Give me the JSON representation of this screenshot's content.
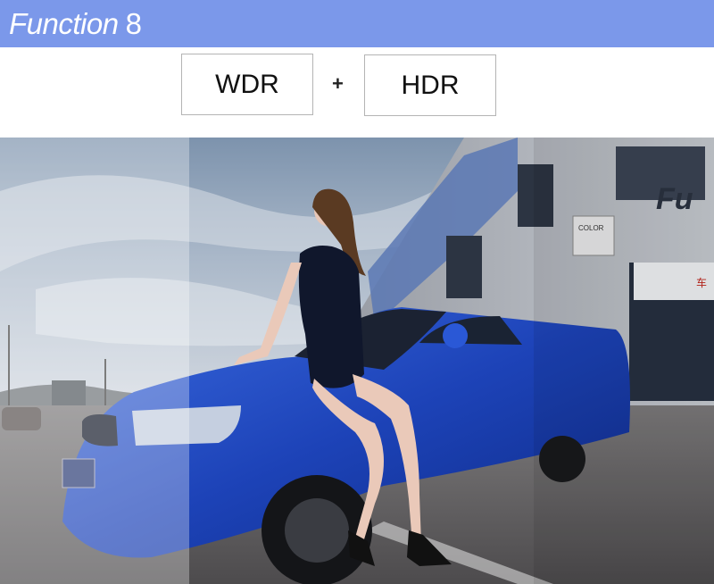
{
  "header": {
    "title": "Function",
    "number": "8"
  },
  "modes": {
    "wdr": "WDR",
    "plus": "+",
    "hdr": "HDR"
  },
  "signs": {
    "store_word": "COLOR",
    "store_brand": "车",
    "banner_top": "Fu"
  }
}
